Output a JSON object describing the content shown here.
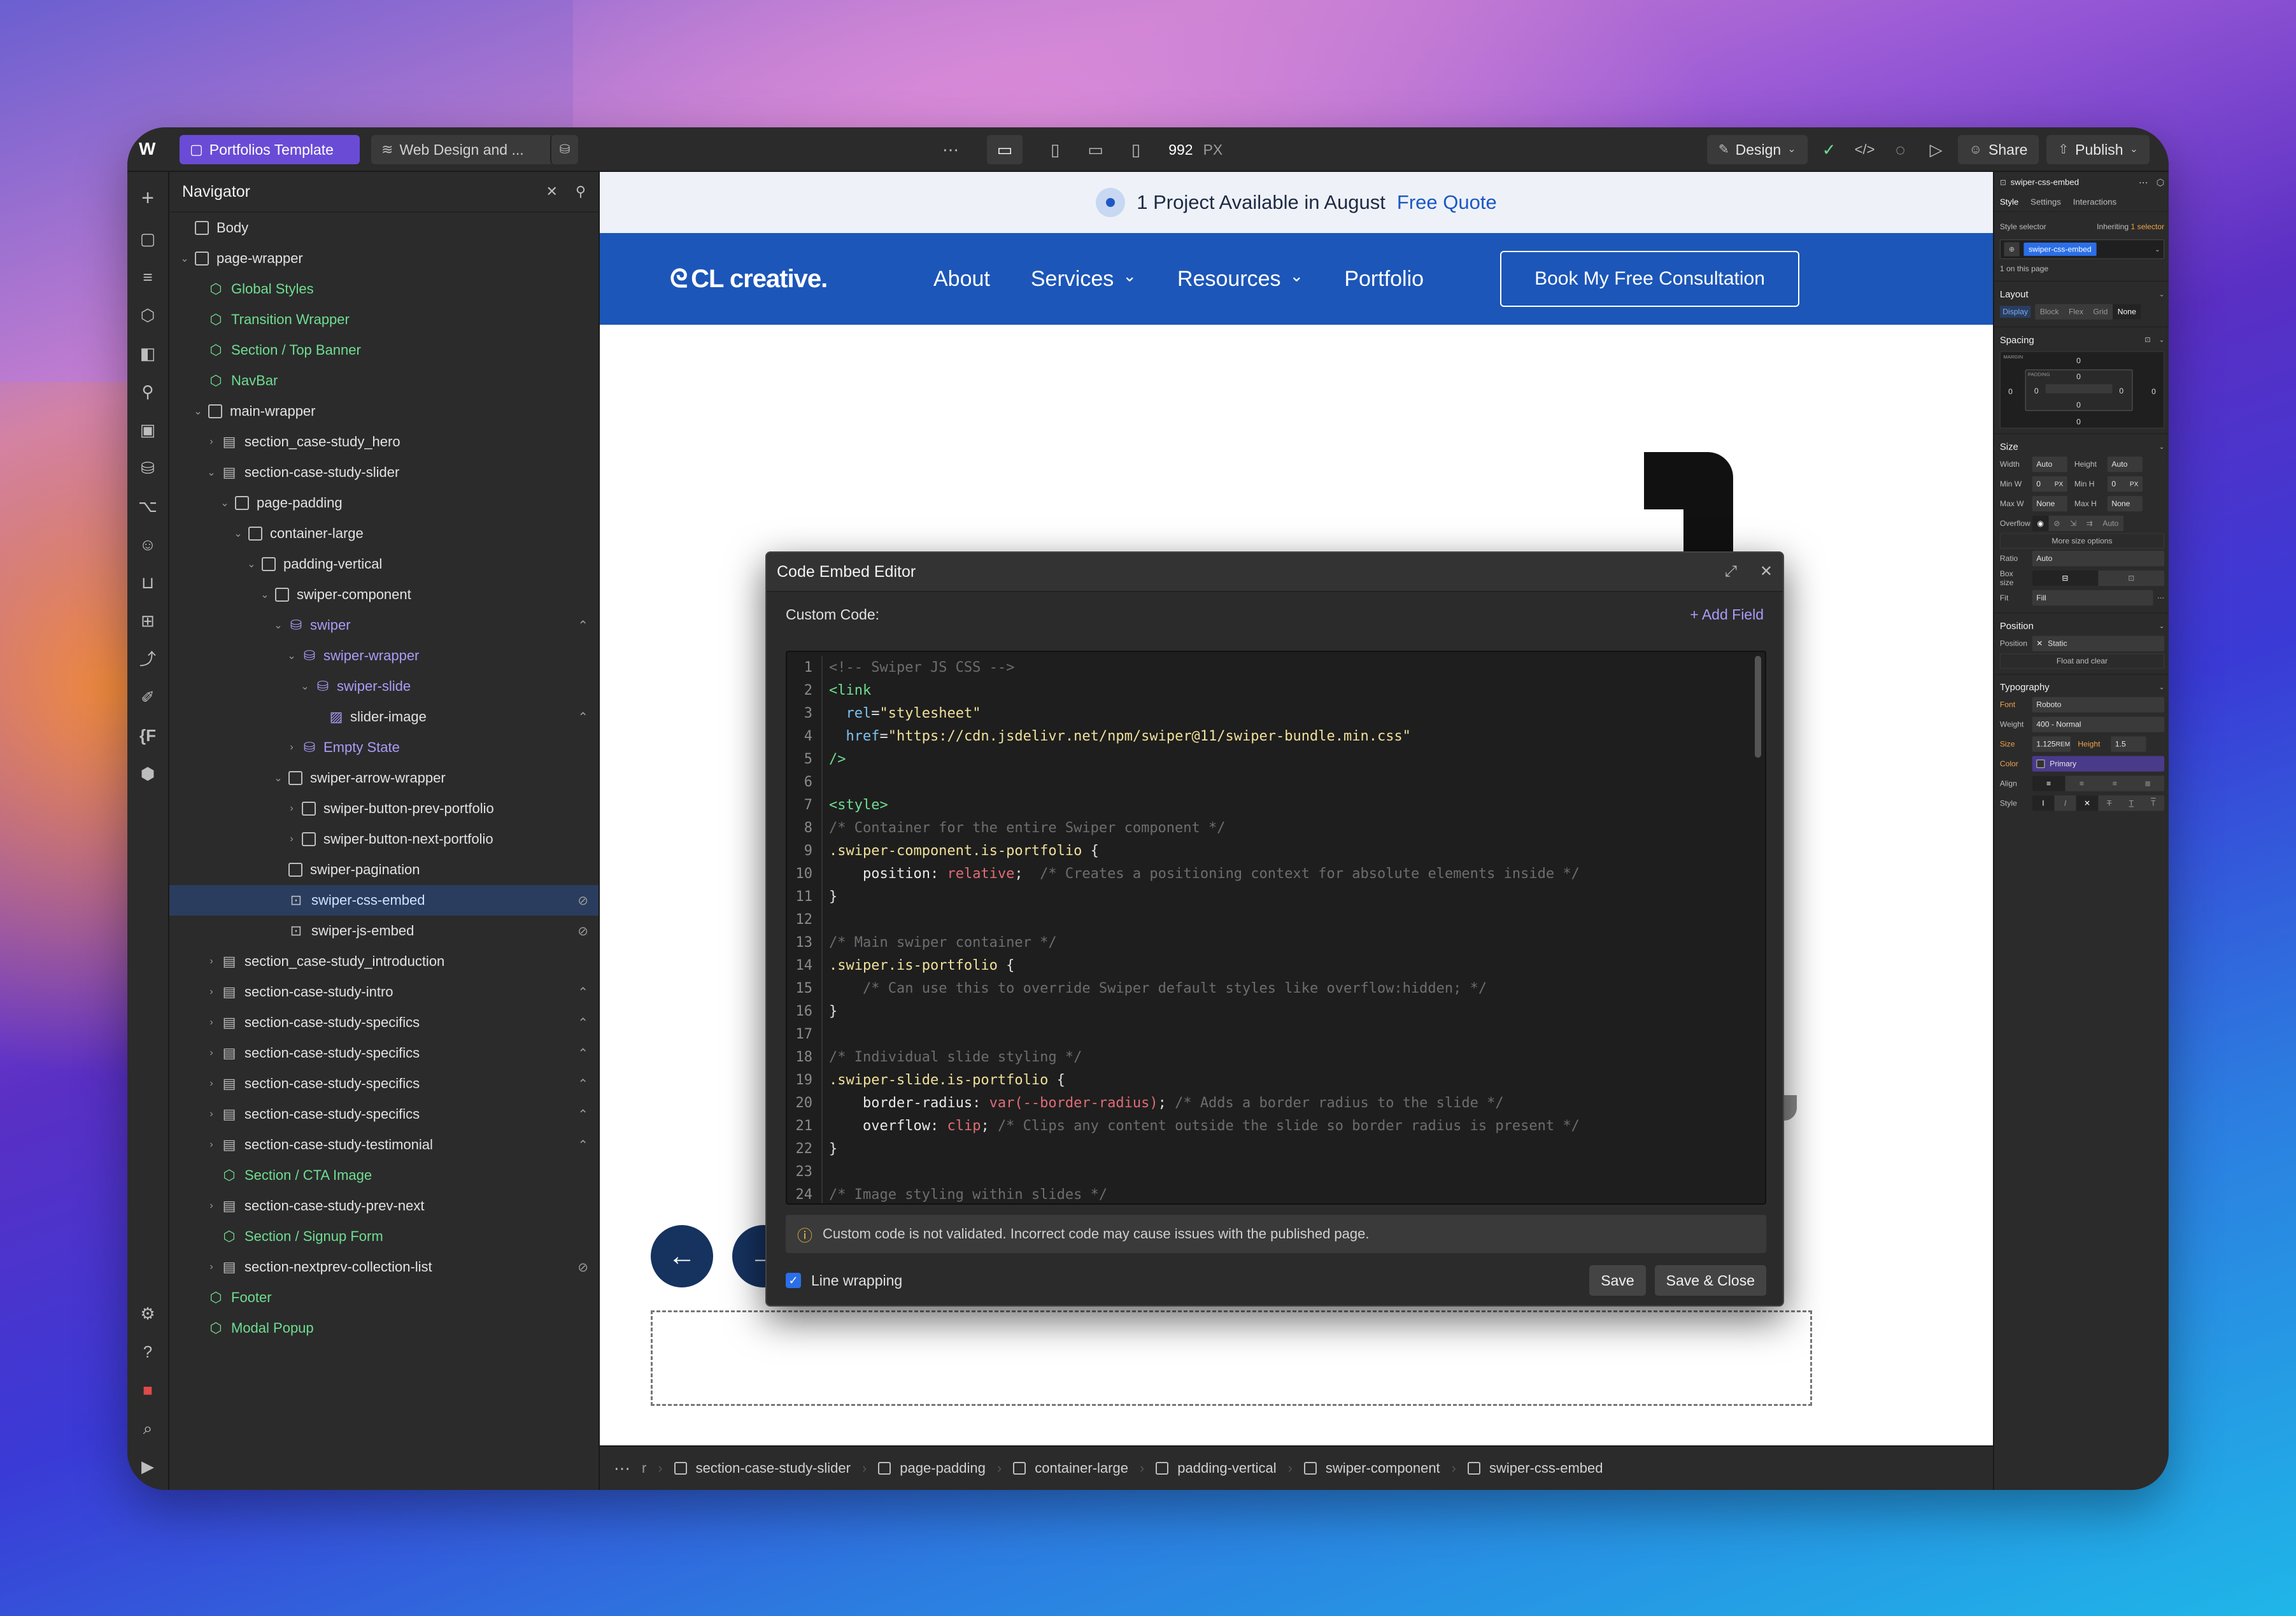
{
  "topbar": {
    "project": "Portfolios Template",
    "page": "Web Design and ...",
    "width_value": "992",
    "width_unit": "PX",
    "mode": "Design",
    "share": "Share",
    "publish": "Publish"
  },
  "navigator": {
    "title": "Navigator",
    "items": [
      {
        "label": "Body",
        "depth": 0,
        "kind": "box",
        "caret": ""
      },
      {
        "label": "page-wrapper",
        "depth": 0,
        "kind": "box",
        "caret": "⌄"
      },
      {
        "label": "Global Styles",
        "depth": 1,
        "kind": "comp",
        "caret": ""
      },
      {
        "label": "Transition Wrapper",
        "depth": 1,
        "kind": "comp",
        "caret": ""
      },
      {
        "label": "Section / Top Banner",
        "depth": 1,
        "kind": "comp",
        "caret": ""
      },
      {
        "label": "NavBar",
        "depth": 1,
        "kind": "comp",
        "caret": ""
      },
      {
        "label": "main-wrapper",
        "depth": 1,
        "kind": "box",
        "caret": "⌄"
      },
      {
        "label": "section_case-study_hero",
        "depth": 2,
        "kind": "sect",
        "caret": "›"
      },
      {
        "label": "section-case-study-slider",
        "depth": 2,
        "kind": "sect",
        "caret": "⌄"
      },
      {
        "label": "page-padding",
        "depth": 3,
        "kind": "box",
        "caret": "⌄"
      },
      {
        "label": "container-large",
        "depth": 4,
        "kind": "box",
        "caret": "⌄"
      },
      {
        "label": "padding-vertical",
        "depth": 5,
        "kind": "box",
        "caret": "⌄"
      },
      {
        "label": "swiper-component",
        "depth": 6,
        "kind": "box",
        "caret": "⌄"
      },
      {
        "label": "swiper",
        "depth": 7,
        "kind": "cms",
        "caret": "⌄",
        "right": "⌃"
      },
      {
        "label": "swiper-wrapper",
        "depth": 8,
        "kind": "cms",
        "caret": "⌄"
      },
      {
        "label": "swiper-slide",
        "depth": 9,
        "kind": "cms",
        "caret": "⌄"
      },
      {
        "label": "slider-image",
        "depth": 10,
        "kind": "img",
        "caret": "",
        "right": "⌃"
      },
      {
        "label": "Empty State",
        "depth": 8,
        "kind": "cms",
        "caret": "›"
      },
      {
        "label": "swiper-arrow-wrapper",
        "depth": 7,
        "kind": "box",
        "caret": "⌄"
      },
      {
        "label": "swiper-button-prev-portfolio",
        "depth": 8,
        "kind": "box",
        "caret": "›"
      },
      {
        "label": "swiper-button-next-portfolio",
        "depth": 8,
        "kind": "box",
        "caret": "›"
      },
      {
        "label": "swiper-pagination",
        "depth": 7,
        "kind": "box",
        "caret": ""
      },
      {
        "label": "swiper-css-embed",
        "depth": 7,
        "kind": "embed",
        "caret": "",
        "right": "⊘",
        "selected": true
      },
      {
        "label": "swiper-js-embed",
        "depth": 7,
        "kind": "embed",
        "caret": "",
        "right": "⊘"
      },
      {
        "label": "section_case-study_introduction",
        "depth": 2,
        "kind": "sect",
        "caret": "›"
      },
      {
        "label": "section-case-study-intro",
        "depth": 2,
        "kind": "sect",
        "caret": "›",
        "right": "⌃"
      },
      {
        "label": "section-case-study-specifics",
        "depth": 2,
        "kind": "sect",
        "caret": "›",
        "right": "⌃"
      },
      {
        "label": "section-case-study-specifics",
        "depth": 2,
        "kind": "sect",
        "caret": "›",
        "right": "⌃"
      },
      {
        "label": "section-case-study-specifics",
        "depth": 2,
        "kind": "sect",
        "caret": "›",
        "right": "⌃"
      },
      {
        "label": "section-case-study-specifics",
        "depth": 2,
        "kind": "sect",
        "caret": "›",
        "right": "⌃"
      },
      {
        "label": "section-case-study-testimonial",
        "depth": 2,
        "kind": "sect",
        "caret": "›",
        "right": "⌃"
      },
      {
        "label": "Section / CTA Image",
        "depth": 2,
        "kind": "comp",
        "caret": ""
      },
      {
        "label": "section-case-study-prev-next",
        "depth": 2,
        "kind": "sect",
        "caret": "›"
      },
      {
        "label": "Section / Signup Form",
        "depth": 2,
        "kind": "comp",
        "caret": ""
      },
      {
        "label": "section-nextprev-collection-list",
        "depth": 2,
        "kind": "sect",
        "caret": "›",
        "right": "⊘"
      },
      {
        "label": "Footer",
        "depth": 1,
        "kind": "comp",
        "caret": ""
      },
      {
        "label": "Modal Popup",
        "depth": 1,
        "kind": "comp",
        "caret": ""
      }
    ]
  },
  "site": {
    "announce_text": "1 Project Available in August",
    "announce_link": "Free Quote",
    "logo": "CL creative.",
    "menu": [
      "About",
      "Services",
      "Resources",
      "Portfolio"
    ],
    "menu_dropdown": [
      false,
      true,
      true,
      false
    ],
    "cta": "Book My Free Consultation"
  },
  "modal": {
    "title": "Code Embed Editor",
    "custom_code_label": "Custom Code:",
    "add_field": "+ Add Field",
    "warning": "Custom code is not validated. Incorrect code may cause issues with the published page.",
    "line_wrapping": "Line wrapping",
    "save": "Save",
    "save_close": "Save & Close",
    "code": [
      [
        [
          "c-com",
          "<!-- Swiper JS CSS -->"
        ]
      ],
      [
        [
          "c-tag",
          "<link"
        ]
      ],
      [
        [
          "c-pl",
          "  "
        ],
        [
          "c-attr",
          "rel"
        ],
        [
          "c-pl",
          "="
        ],
        [
          "c-str",
          "\"stylesheet\""
        ]
      ],
      [
        [
          "c-pl",
          "  "
        ],
        [
          "c-attr",
          "href"
        ],
        [
          "c-pl",
          "="
        ],
        [
          "c-str",
          "\"https://cdn.jsdelivr.net/npm/swiper@11/swiper-bundle.min.css\""
        ]
      ],
      [
        [
          "c-tag",
          "/>"
        ]
      ],
      [],
      [
        [
          "c-tag",
          "<style>"
        ]
      ],
      [
        [
          "c-com",
          "/* Container for the entire Swiper component */"
        ]
      ],
      [
        [
          "c-sel",
          ".swiper-component.is-portfolio"
        ],
        [
          "c-pl",
          " {"
        ]
      ],
      [
        [
          "c-pl",
          "    "
        ],
        [
          "c-prop",
          "position"
        ],
        [
          "c-pl",
          ": "
        ],
        [
          "c-val",
          "relative"
        ],
        [
          "c-pl",
          ";  "
        ],
        [
          "c-com",
          "/* Creates a positioning context for absolute elements inside */"
        ]
      ],
      [
        [
          "c-pl",
          "}"
        ]
      ],
      [],
      [
        [
          "c-com",
          "/* Main swiper container */"
        ]
      ],
      [
        [
          "c-sel",
          ".swiper.is-portfolio"
        ],
        [
          "c-pl",
          " {"
        ]
      ],
      [
        [
          "c-pl",
          "    "
        ],
        [
          "c-com",
          "/* Can use this to override Swiper default styles like overflow:hidden; */"
        ]
      ],
      [
        [
          "c-pl",
          "}"
        ]
      ],
      [],
      [
        [
          "c-com",
          "/* Individual slide styling */"
        ]
      ],
      [
        [
          "c-sel",
          ".swiper-slide.is-portfolio"
        ],
        [
          "c-pl",
          " {"
        ]
      ],
      [
        [
          "c-pl",
          "    "
        ],
        [
          "c-prop",
          "border-radius"
        ],
        [
          "c-pl",
          ": "
        ],
        [
          "c-val",
          "var(--border-radius)"
        ],
        [
          "c-pl",
          "; "
        ],
        [
          "c-com",
          "/* Adds a border radius to the slide */"
        ]
      ],
      [
        [
          "c-pl",
          "    "
        ],
        [
          "c-prop",
          "overflow"
        ],
        [
          "c-pl",
          ": "
        ],
        [
          "c-val",
          "clip"
        ],
        [
          "c-pl",
          "; "
        ],
        [
          "c-com",
          "/* Clips any content outside the slide so border radius is present */"
        ]
      ],
      [
        [
          "c-pl",
          "}"
        ]
      ],
      [],
      [
        [
          "c-com",
          "/* Image styling within slides */"
        ]
      ]
    ]
  },
  "breadcrumb": [
    "section-case-study-slider",
    "page-padding",
    "container-large",
    "padding-vertical",
    "swiper-component",
    "swiper-css-embed"
  ],
  "breadcrumb_truncated": "r",
  "style_panel": {
    "element": "swiper-css-embed",
    "tabs": [
      "Style",
      "Settings",
      "Interactions"
    ],
    "style_selector": "Style selector",
    "inheriting": "Inheriting",
    "inheriting_count": "1 selector",
    "selector_chip": "swiper-css-embed",
    "on_page": "1 on this page",
    "layout": {
      "title": "Layout",
      "display": "Display",
      "options": [
        "Block",
        "Flex",
        "Grid",
        "None"
      ]
    },
    "spacing": {
      "title": "Spacing",
      "margin_label": "MARGIN",
      "padding_label": "PADDING",
      "zero": "0"
    },
    "size": {
      "title": "Size",
      "width": "Width",
      "height": "Height",
      "auto": "Auto",
      "minw": "Min W",
      "minh": "Min H",
      "zero": "0",
      "px": "PX",
      "maxw": "Max W",
      "maxh": "Max H",
      "none": "None",
      "overflow": "Overflow",
      "overflow_auto": "Auto",
      "more": "More size options",
      "ratio": "Ratio",
      "ratio_val": "Auto",
      "boxsize": "Box size",
      "fit": "Fit",
      "fit_val": "Fill"
    },
    "position": {
      "title": "Position",
      "label": "Position",
      "value": "Static",
      "float": "Float and clear"
    },
    "typography": {
      "title": "Typography",
      "font": "Font",
      "font_val": "Roboto",
      "weight": "Weight",
      "weight_val": "400 - Normal",
      "size": "Size",
      "size_val": "1.125",
      "size_unit": "REM",
      "height": "Height",
      "height_val": "1.5",
      "color": "Color",
      "color_val": "Primary",
      "align": "Align",
      "style": "Style"
    }
  },
  "colors": {
    "accent": "#6a4bd6",
    "site_blue": "#1c56b8",
    "selected_row": "#2a3d5e",
    "component_green": "#6fdd91",
    "cms_purple": "#a99cf7"
  }
}
